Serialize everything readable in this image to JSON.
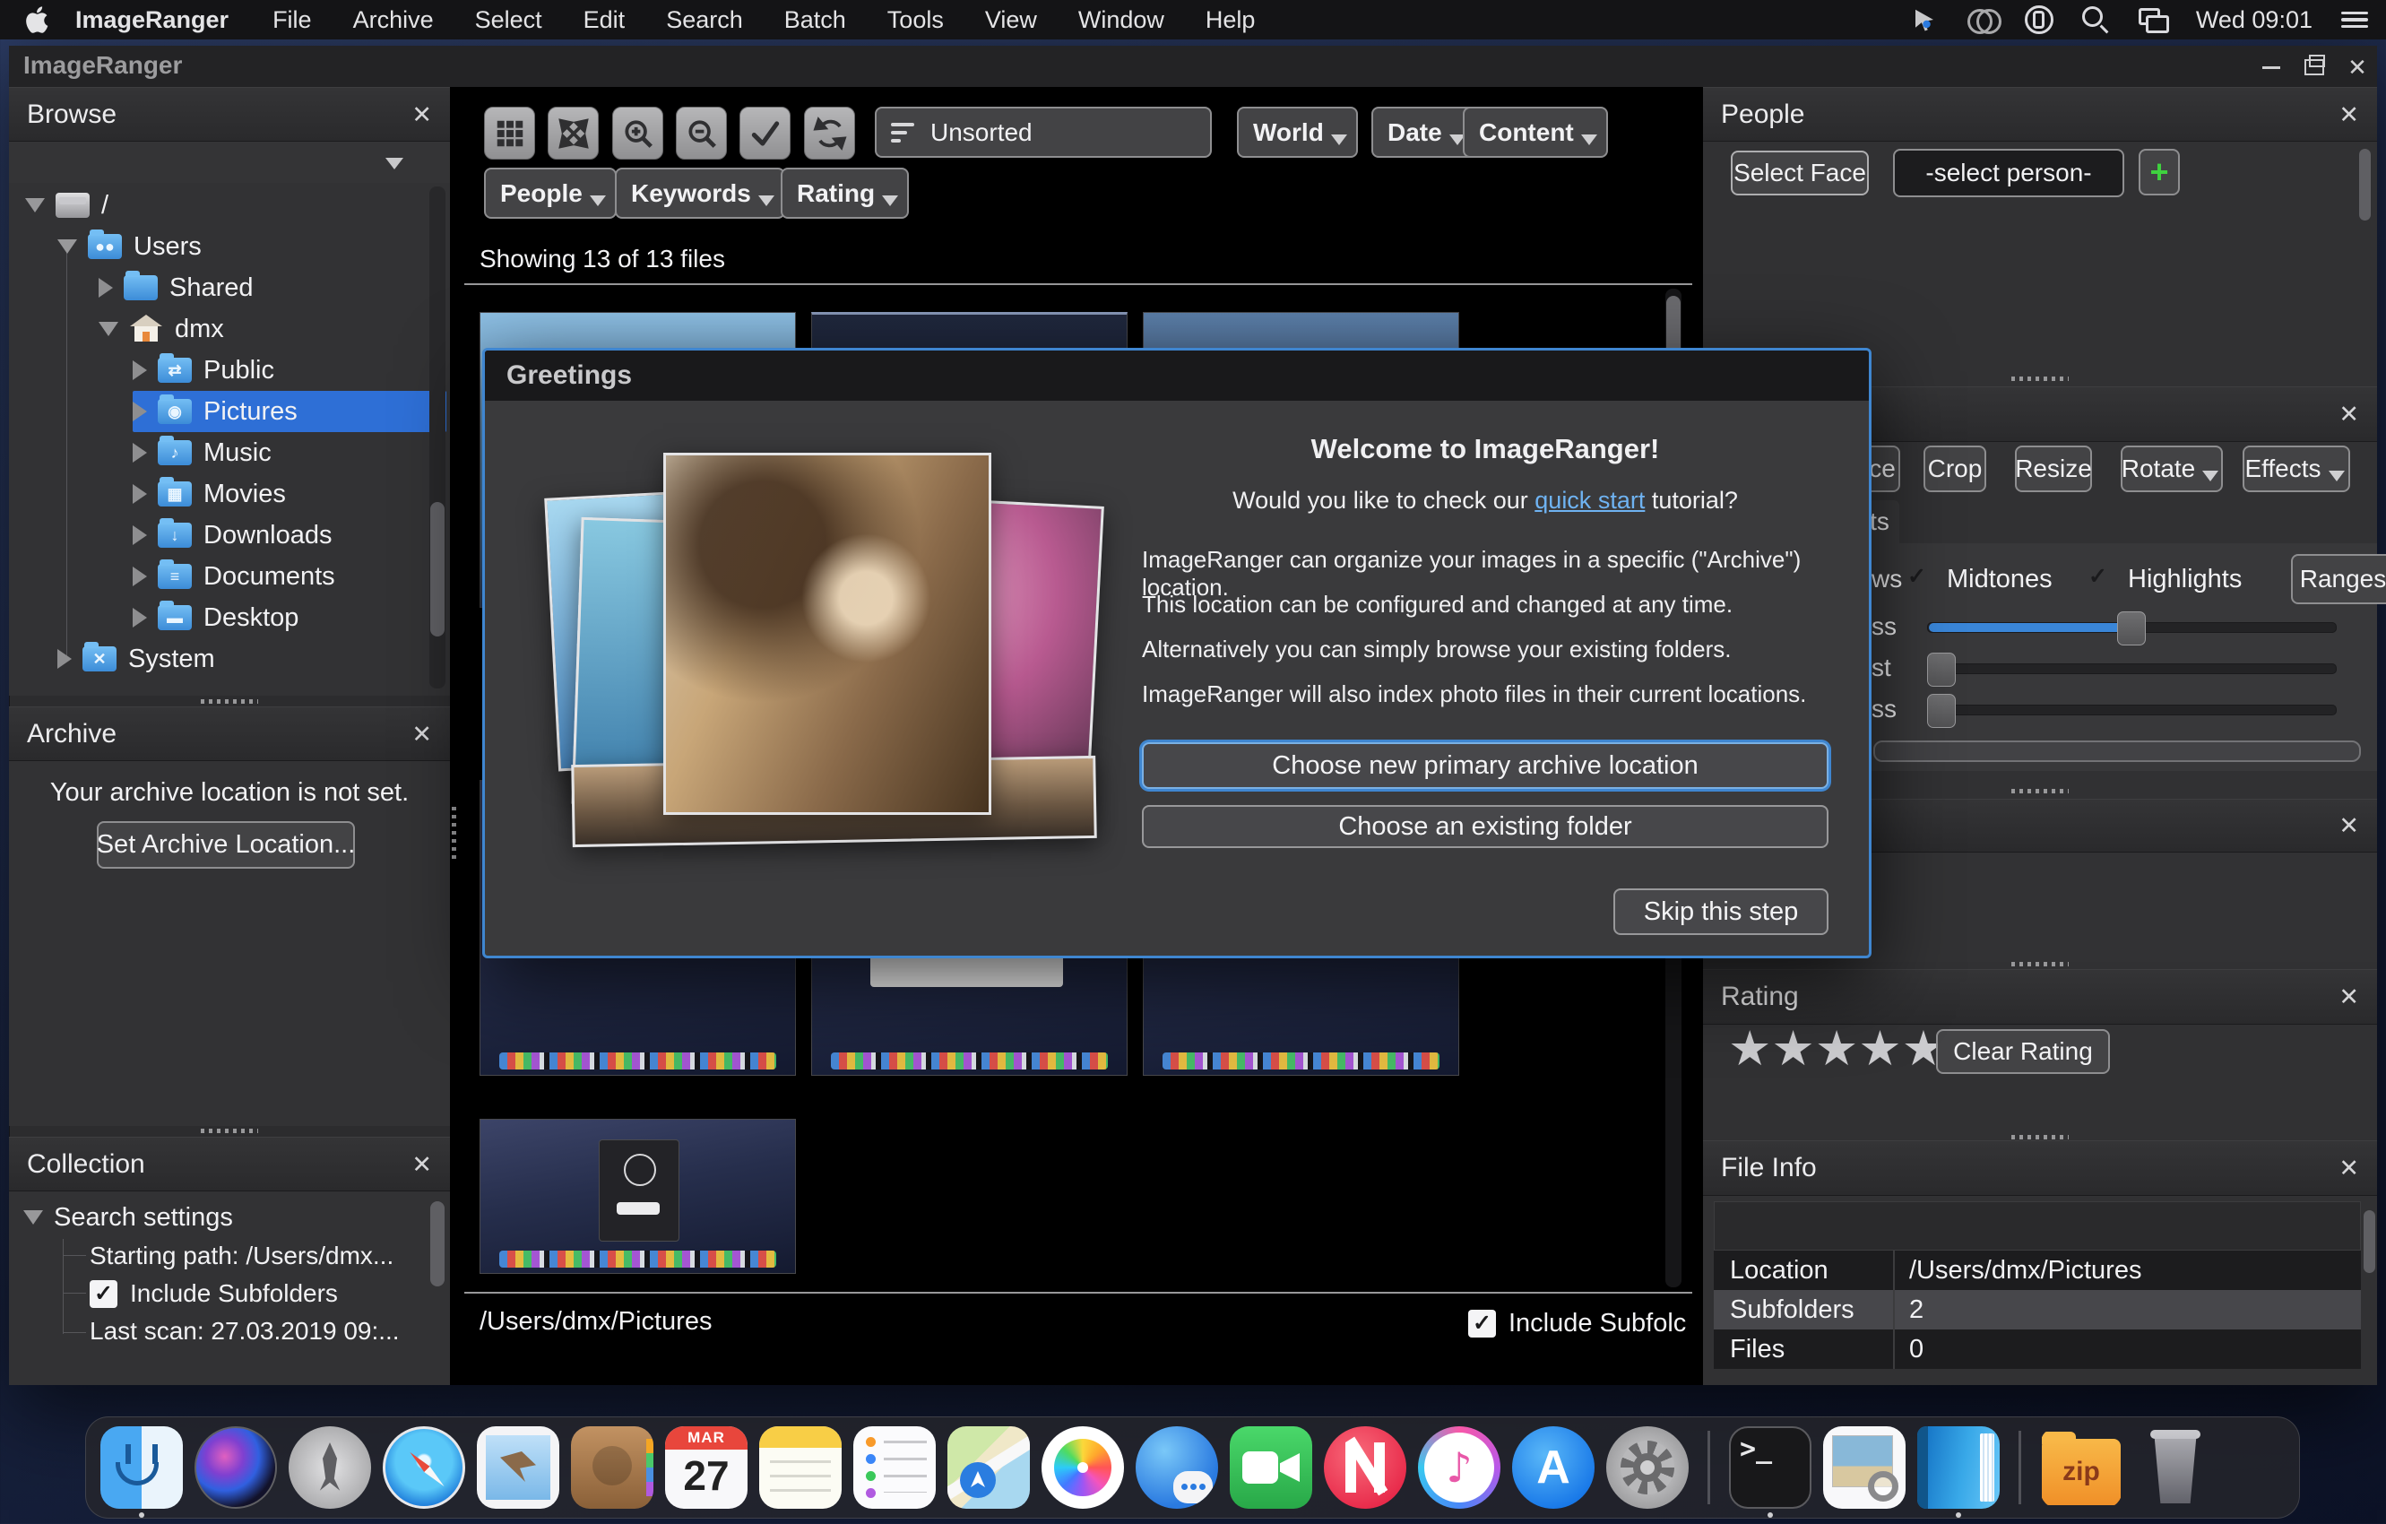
{
  "menu_bar": {
    "app_name": "ImageRanger",
    "items": [
      "File",
      "Archive",
      "Select",
      "Edit",
      "Search",
      "Batch",
      "Tools",
      "View",
      "Window",
      "Help"
    ],
    "clock": "Wed 09:01"
  },
  "window": {
    "title": "ImageRanger"
  },
  "sidebar": {
    "browse": {
      "title": "Browse"
    },
    "tree": [
      {
        "label": "/"
      },
      {
        "label": "Users"
      },
      {
        "label": "Shared"
      },
      {
        "label": "dmx"
      },
      {
        "label": "Public"
      },
      {
        "label": "Pictures"
      },
      {
        "label": "Music"
      },
      {
        "label": "Movies"
      },
      {
        "label": "Downloads"
      },
      {
        "label": "Documents"
      },
      {
        "label": "Desktop"
      },
      {
        "label": "System"
      }
    ],
    "archive": {
      "title": "Archive",
      "message": "Your archive location is not set.",
      "set_location_button": "Set Archive Location..."
    },
    "collection": {
      "title": "Collection",
      "root_label": "Search settings",
      "starting_path": "Starting path: /Users/dmx...",
      "include_subfolders": "Include Subfolders",
      "last_scan": "Last scan: 27.03.2019 09:..."
    }
  },
  "toolbar": {
    "sort_value": "Unsorted",
    "filter_world": "World",
    "filter_date": "Date",
    "filter_content": "Content",
    "filter_people": "People",
    "filter_keywords": "Keywords",
    "filter_rating": "Rating"
  },
  "content": {
    "showing_text": "Showing 13 of 13 files",
    "current_path": "/Users/dmx/Pictures",
    "include_subfolders_label": "Include Subfolc"
  },
  "dialog": {
    "title": "Greetings",
    "heading": "Welcome to ImageRanger!",
    "question_prefix": "Would you like to check our ",
    "question_link": "quick start",
    "question_suffix": " tutorial?",
    "line1": "ImageRanger can organize your images in a specific (\"Archive\") location.",
    "line2": "This location can be configured and changed at any time.",
    "line3": "Alternatively you can simply browse your existing folders.",
    "line4": "ImageRanger will also index photo files in their current locations.",
    "primary_button": "Choose new primary archive location",
    "secondary_button": "Choose an existing folder",
    "skip_button": "Skip this step"
  },
  "people_panel": {
    "title": "People",
    "select_face_button": "Select Face",
    "person_select": "-select person-",
    "add_button": "+"
  },
  "edit_panel": {
    "button_partial": "ce",
    "crop": "Crop",
    "resize": "Resize",
    "rotate": "Rotate",
    "effects": "Effects",
    "tab_partial": "ts",
    "shadows_partial": "ws",
    "midtones": "Midtones",
    "highlights": "Highlights",
    "ranges": "Ranges",
    "slider1_label": "ss",
    "slider2_label": "st",
    "slider3_label": "ss"
  },
  "rating_panel": {
    "title": "Rating",
    "clear_button": "Clear Rating",
    "stars": 5
  },
  "file_info": {
    "title": "File Info",
    "rows": [
      {
        "key": "Location",
        "value": "/Users/dmx/Pictures"
      },
      {
        "key": "Subfolders",
        "value": "2"
      },
      {
        "key": "Files",
        "value": "0"
      }
    ]
  },
  "colors": {
    "accent_blue": "#3f86d0",
    "selection_blue": "#2e6fd6",
    "link_blue": "#6fb3f2",
    "plus_green": "#3fd23f"
  },
  "dock": {
    "calendar_month": "MAR",
    "calendar_day": "27",
    "zip_label": "zip"
  }
}
